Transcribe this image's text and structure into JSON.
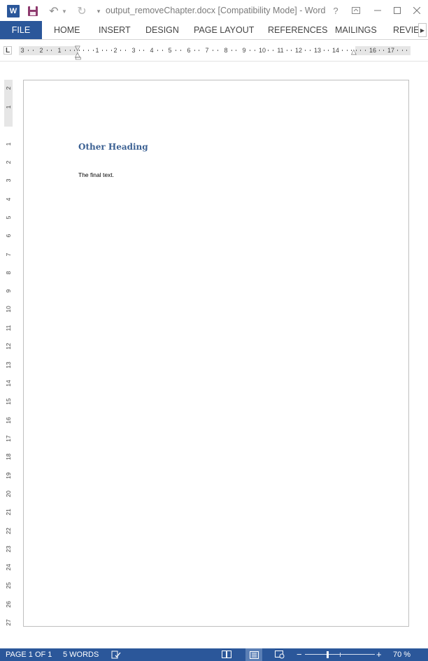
{
  "window": {
    "title": "output_removeChapter.docx [Compatibility Mode] - Word",
    "app_logo_letter": "W",
    "help": "?"
  },
  "ribbon": {
    "file_tab": "FILE",
    "tabs": [
      "HOME",
      "INSERT",
      "DESIGN",
      "PAGE LAYOUT",
      "REFERENCES",
      "MAILINGS",
      "REVIEW"
    ]
  },
  "ruler": {
    "horizontal_labels": [
      "3",
      "2",
      "1",
      "1",
      "2",
      "3",
      "4",
      "5",
      "6",
      "7",
      "8",
      "9",
      "10",
      "11",
      "12",
      "13",
      "14",
      "16",
      "17"
    ],
    "vertical_labels": [
      "2",
      "1",
      "1",
      "2",
      "3",
      "4",
      "5",
      "6",
      "7",
      "8",
      "9",
      "10",
      "11",
      "12",
      "13",
      "14",
      "15",
      "16",
      "17",
      "18",
      "19",
      "20",
      "21",
      "22",
      "23",
      "24",
      "25",
      "26",
      "27"
    ],
    "tab_selector": "L"
  },
  "document": {
    "heading": "Other Heading",
    "body": "The final text."
  },
  "status": {
    "page": "PAGE 1 OF 1",
    "words": "5 WORDS",
    "zoom_out": "−",
    "zoom_in": "+",
    "zoom": "70 %"
  },
  "colors": {
    "accent": "#2b579a",
    "heading": "#3c6193"
  }
}
